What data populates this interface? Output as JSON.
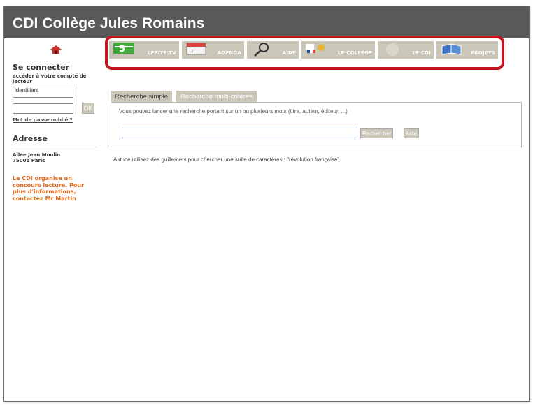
{
  "header": {
    "title": "CDI Collège Jules Romains"
  },
  "nav": {
    "items": [
      {
        "label": "LESITE.TV",
        "icon": "lesite-tv-icon"
      },
      {
        "label": "AGENDA",
        "icon": "calendar-icon"
      },
      {
        "label": "AIDE",
        "icon": "magnifier-icon"
      },
      {
        "label": "LE COLLEGE",
        "icon": "college-logo-icon"
      },
      {
        "label": "LE CDI",
        "icon": "cdi-icon"
      },
      {
        "label": "PROJETS",
        "icon": "book-icon"
      }
    ]
  },
  "sidebar": {
    "login_title": "Se connecter",
    "login_subtitle": "accéder à votre compte de lecteur",
    "username_value": "identifiant",
    "ok_label": "OK",
    "forgot_label": "Mot de passe oublié ?",
    "address_title": "Adresse",
    "address_line1": "Allée Jean Moulin",
    "address_line2": "75001 Paris",
    "news": "Le CDI organise un concours lecture. Pour plus d'informations, contactez Mr Martin"
  },
  "search": {
    "tab_simple": "Recherche simple",
    "tab_multi": "Recherche multi-critères",
    "hint": "Vous pouvez lancer une recherche portant sur un ou plusieurs mots (titre, auteur, éditeur, ...)",
    "query_value": "",
    "search_button": "Rechercher",
    "help_button": "Aide"
  },
  "tip": "Astuce utilisez des guillemets pour chercher une suite de caractères : \"révolution française\"",
  "colors": {
    "header_bg": "#59595a",
    "nav_bg": "#cbc7b8",
    "highlight": "#c1121f",
    "news_text": "#e8681b"
  }
}
